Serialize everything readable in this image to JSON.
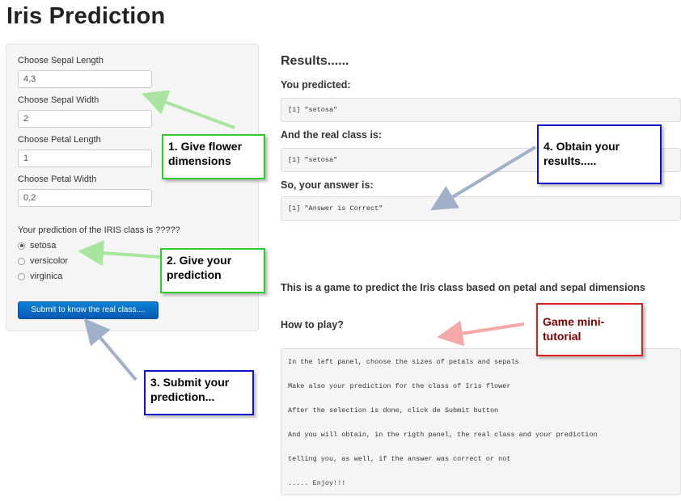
{
  "page": {
    "title": "Iris Prediction"
  },
  "sidebar": {
    "sepal_length": {
      "label": "Choose Sepal Length",
      "value": "4,3"
    },
    "sepal_width": {
      "label": "Choose Sepal Width",
      "value": "2"
    },
    "petal_length": {
      "label": "Choose Petal Length",
      "value": "1"
    },
    "petal_width": {
      "label": "Choose Petal Width",
      "value": "0,2"
    },
    "prediction_label": "Your prediction of the IRIS class is ?????",
    "options": [
      "setosa",
      "versicolor",
      "virginica"
    ],
    "selected_option": "setosa",
    "submit_label": "Submit to know the real class...."
  },
  "results": {
    "heading": "Results......",
    "you_predicted_label": "You predicted:",
    "you_predicted_value": "[1] \"setosa\"",
    "real_class_label": "And the real class is:",
    "real_class_value": "[1] \"setosa\"",
    "answer_label": "So, your answer is:",
    "answer_value": "[1] \"Answer is Correct\""
  },
  "info": {
    "description": "This is a game to predict the Iris class based on petal and sepal dimensions",
    "how_to_play_label": "How to play?",
    "tutorial_lines": [
      "In the left panel, choose the sizes of petals and sepals",
      "Make also your prediction for the class of Iris flower",
      "After the selection is done, click de Submit button",
      "And you will obtain, in the rigth panel, the real class and your prediction",
      "telling you, as well, if the answer was correct or not",
      "..... Enjoy!!!"
    ]
  },
  "annotations": {
    "step1": {
      "line1": "1. Give flower",
      "line2": "dimensions",
      "color": "#2ecc2e"
    },
    "step2": {
      "line1": "2. Give your",
      "line2": "prediction",
      "color": "#2ecc2e"
    },
    "step3": {
      "line1": "3. Submit your",
      "line2": "prediction...",
      "color": "#1010c8"
    },
    "step4": {
      "line1": "4. Obtain your",
      "line2": "results.....",
      "color": "#1010c8"
    },
    "tutorial": {
      "line1": "Game mini-",
      "line2": "tutorial",
      "color": "#e02020",
      "text_color": "#7a0000"
    }
  },
  "colors": {
    "accent_button": "#0a6fc8",
    "arrow_green": "#a8e6a0",
    "arrow_blue": "#9fb0c8",
    "arrow_red": "#f4a8a8"
  }
}
